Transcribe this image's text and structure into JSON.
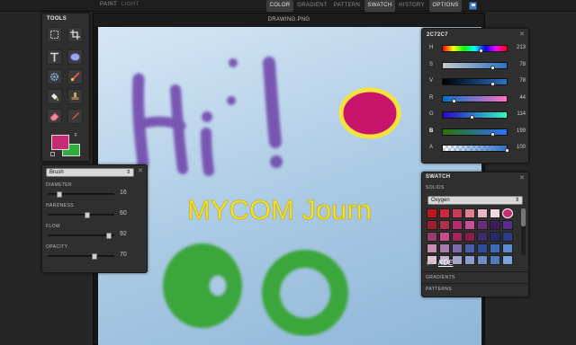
{
  "topbar": {
    "modes": [
      "PAINT",
      "LIGHT"
    ],
    "tabs": [
      {
        "label": "COLOR",
        "active": true
      },
      {
        "label": "GRADIENT",
        "active": false
      },
      {
        "label": "PATTERN",
        "active": false
      },
      {
        "label": "SWATCH",
        "active": true
      },
      {
        "label": "HISTORY",
        "active": false
      },
      {
        "label": "OPTIONS",
        "active": true
      }
    ],
    "save_icon": "save-icon"
  },
  "document": {
    "title": "DRAWING.PNG",
    "canvas_text": "MYCOM Journ",
    "handwriting": "Hi!"
  },
  "tools": {
    "title": "TOOLS",
    "buttons": [
      "marquee-icon",
      "crop-icon",
      "text-icon",
      "ellipse-icon",
      "settings-icon",
      "brush-icon",
      "fill-icon",
      "stamp-icon",
      "eraser-icon",
      "dropper-icon"
    ],
    "primary_color": "#c72c72",
    "secondary_color": "#2fae3e",
    "swap_label": "F"
  },
  "brush": {
    "preset": "Brush",
    "params": [
      {
        "label": "DIAMETER",
        "value": 16,
        "pos": 0.18
      },
      {
        "label": "HARDNESS",
        "value": 60,
        "pos": 0.6
      },
      {
        "label": "FLOW",
        "value": 92,
        "pos": 0.92
      },
      {
        "label": "OPACITY",
        "value": 70,
        "pos": 0.7
      }
    ]
  },
  "color": {
    "title": "2C72C7",
    "rows": [
      {
        "ch": "H",
        "value": 213,
        "pos": 0.59,
        "bold": false
      },
      {
        "ch": "S",
        "value": 78,
        "pos": 0.78,
        "bold": false
      },
      {
        "ch": "V",
        "value": 78,
        "pos": 0.78,
        "bold": false
      },
      {
        "ch": "R",
        "value": 44,
        "pos": 0.17,
        "bold": false
      },
      {
        "ch": "G",
        "value": 114,
        "pos": 0.45,
        "bold": false
      },
      {
        "ch": "B",
        "value": 199,
        "pos": 0.78,
        "bold": true
      },
      {
        "ch": "A",
        "value": 100,
        "pos": 1.0,
        "bold": false
      }
    ]
  },
  "swatch": {
    "title": "SWATCH",
    "section": "SOLIDS",
    "set": "Oxygen",
    "by_label": "BY:",
    "author": "KDE",
    "footer": [
      "GRADIENTS",
      "PATTERNS"
    ],
    "colors": [
      "#c4141c",
      "#d0283a",
      "#c83a58",
      "#e08090",
      "#e8b6c4",
      "#f0d8de",
      "#c72c72",
      "#9c1e2c",
      "#b4304a",
      "#b42c6c",
      "#cc4c9c",
      "#6c2c7c",
      "#3c1c5c",
      "#5c2c8c",
      "#9c3c6c",
      "#c84c8c",
      "#a4245c",
      "#8c1c4c",
      "#3c2c6c",
      "#242c6c",
      "#2c3c8c",
      "#c890b0",
      "#a87ca8",
      "#7c6cac",
      "#4c5cac",
      "#2c4c9c",
      "#3c6cbc",
      "#5c8ccc",
      "#dcc4d4",
      "#c4b4d4",
      "#a4a4cc",
      "#8c9ccc",
      "#6c8cc4",
      "#4c7cbc",
      "#7ca4dc"
    ]
  }
}
